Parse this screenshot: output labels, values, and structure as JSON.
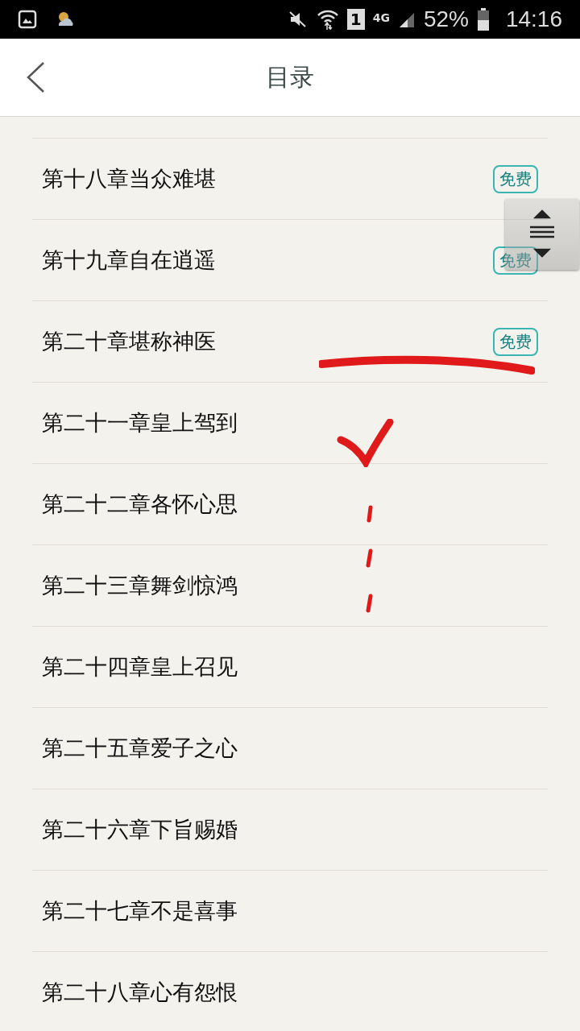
{
  "status_bar": {
    "sim_slot": "1",
    "network": "4G",
    "battery": "52%",
    "time": "14:16"
  },
  "header": {
    "title": "目录"
  },
  "chapters": [
    {
      "title": "第十八章当众难堪",
      "badge": "免费"
    },
    {
      "title": "第十九章自在逍遥",
      "badge": "免费"
    },
    {
      "title": "第二十章堪称神医",
      "badge": "免费"
    },
    {
      "title": "第二十一章皇上驾到"
    },
    {
      "title": "第二十二章各怀心思"
    },
    {
      "title": "第二十三章舞剑惊鸿"
    },
    {
      "title": "第二十四章皇上召见"
    },
    {
      "title": "第二十五章爱子之心"
    },
    {
      "title": "第二十六章下旨赐婚"
    },
    {
      "title": "第二十七章不是喜事"
    },
    {
      "title": "第二十八章心有怨恨"
    }
  ]
}
